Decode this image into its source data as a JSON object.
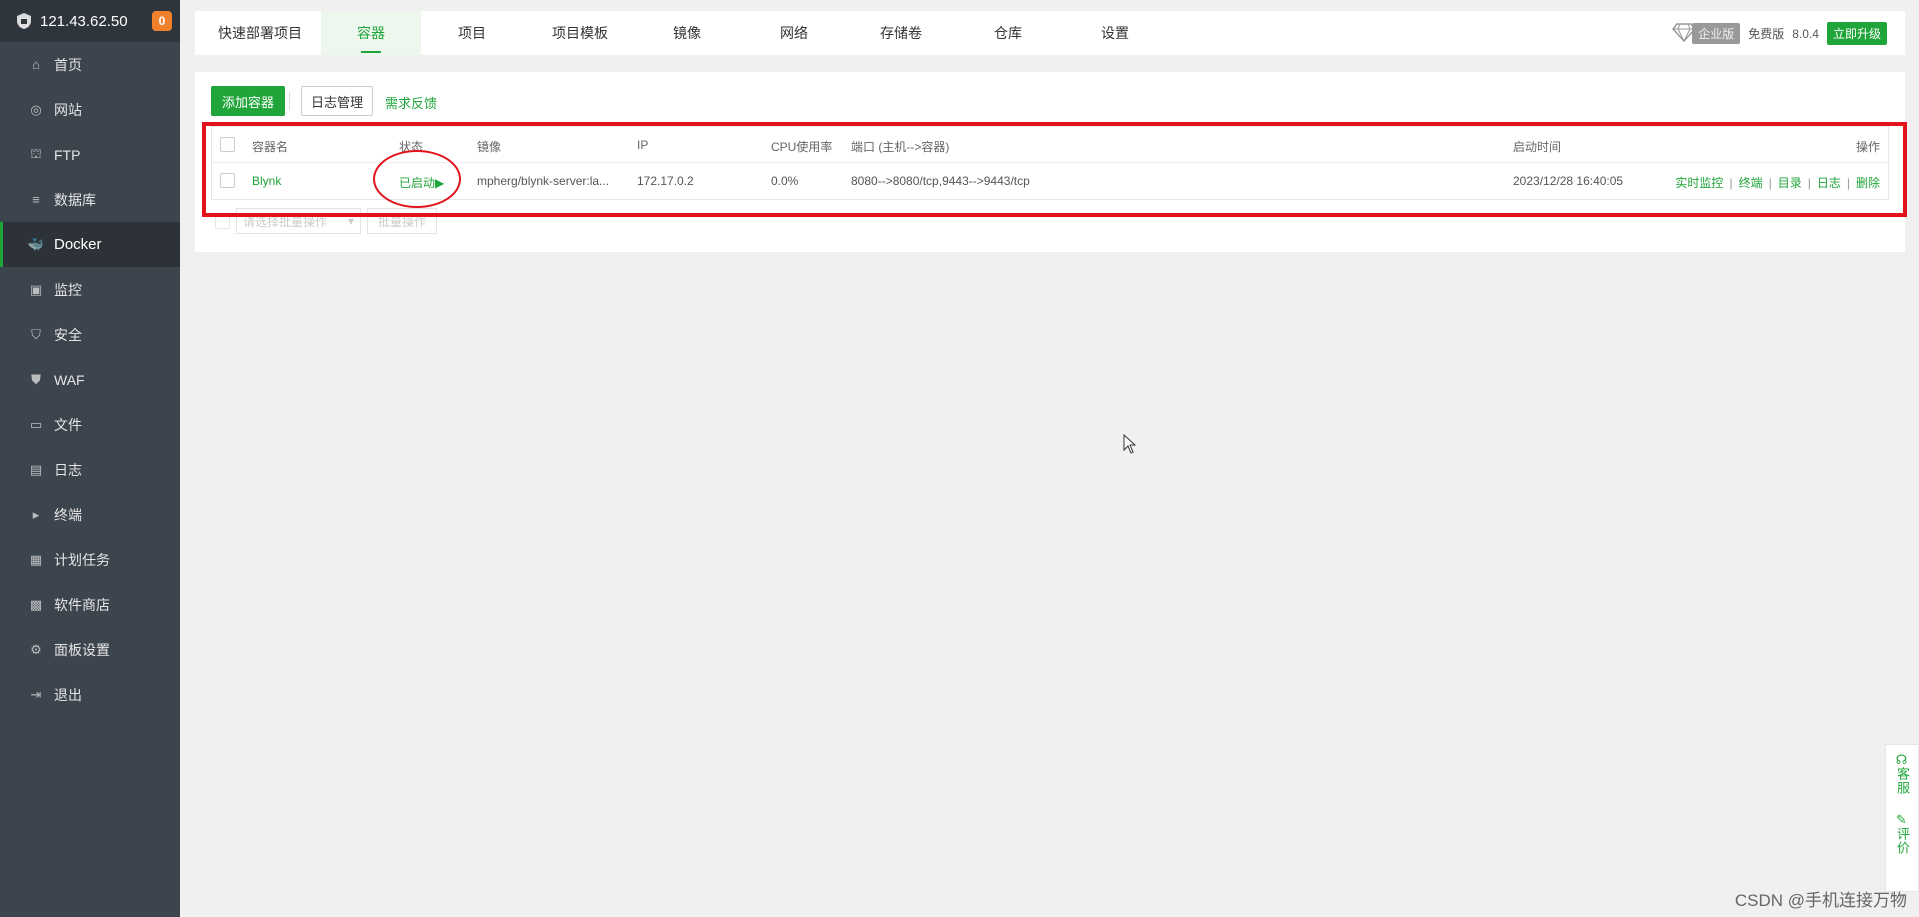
{
  "sidebar": {
    "server": "121.43.62.50",
    "badge": "0",
    "items": [
      {
        "label": "首页",
        "icon": "home-icon"
      },
      {
        "label": "网站",
        "icon": "globe-icon"
      },
      {
        "label": "FTP",
        "icon": "ftp-icon"
      },
      {
        "label": "数据库",
        "icon": "database-icon"
      },
      {
        "label": "Docker",
        "icon": "docker-icon"
      },
      {
        "label": "监控",
        "icon": "monitor-icon"
      },
      {
        "label": "安全",
        "icon": "shield-icon"
      },
      {
        "label": "WAF",
        "icon": "waf-shield-icon"
      },
      {
        "label": "文件",
        "icon": "folder-icon"
      },
      {
        "label": "日志",
        "icon": "log-icon"
      },
      {
        "label": "终端",
        "icon": "terminal-icon"
      },
      {
        "label": "计划任务",
        "icon": "calendar-icon"
      },
      {
        "label": "软件商店",
        "icon": "apps-icon"
      },
      {
        "label": "面板设置",
        "icon": "gear-icon"
      },
      {
        "label": "退出",
        "icon": "logout-icon"
      }
    ],
    "active": "Docker"
  },
  "topnav": {
    "tabs": [
      "快速部署项目",
      "容器",
      "项目",
      "项目模板",
      "镜像",
      "网络",
      "存储卷",
      "仓库",
      "设置"
    ],
    "active": "容器",
    "enterprise": "企业版",
    "edition": "免费版",
    "version": "8.0.4",
    "upgrade": "立即升级"
  },
  "toolbar": {
    "add": "添加容器",
    "logs": "日志管理",
    "feedback": "需求反馈"
  },
  "table": {
    "headers": {
      "name": "容器名",
      "status": "状态",
      "image": "镜像",
      "ip": "IP",
      "cpu": "CPU使用率",
      "ports": "端口 (主机-->容器)",
      "started": "启动时间",
      "ops": "操作"
    },
    "rows": [
      {
        "name": "Blynk",
        "status": "已启动",
        "image": "mpherg/blynk-server:la...",
        "ip": "172.17.0.2",
        "cpu": "0.0%",
        "ports": "8080-->8080/tcp,9443-->9443/tcp",
        "started": "2023/12/28 16:40:05",
        "ops": [
          "实时监控",
          "终端",
          "目录",
          "日志",
          "删除"
        ]
      }
    ]
  },
  "batch": {
    "placeholder": "请选择批量操作",
    "button": "批量操作"
  },
  "float": {
    "service": "客服",
    "rate": "评价"
  },
  "watermark": "CSDN @手机连接万物",
  "colors": {
    "accent": "#20a53a",
    "sidebar": "#3c444d",
    "annotation": "#e1141c"
  }
}
